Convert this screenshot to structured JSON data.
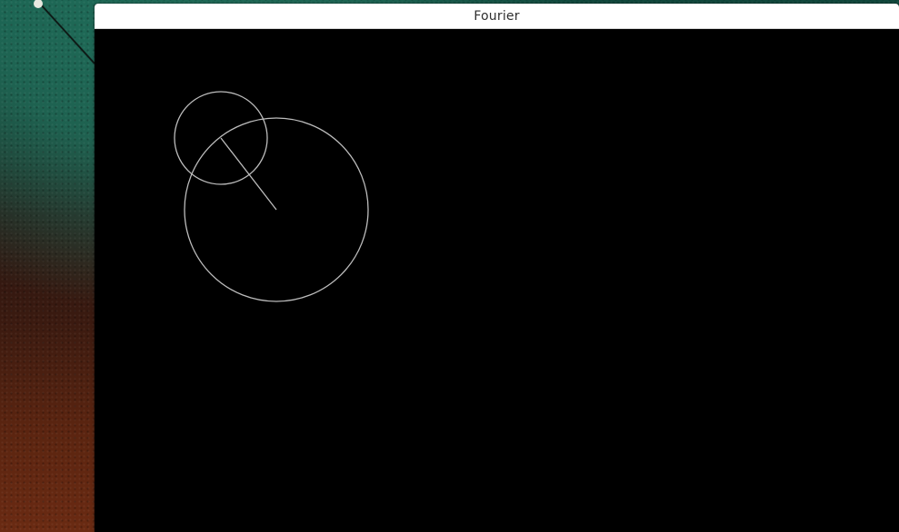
{
  "window": {
    "title": "Fourier"
  },
  "colors": {
    "canvas_background": "#000000",
    "stroke": "#bdbdbd",
    "titlebar_background": "#ffffff",
    "title_text": "#2e2e2e"
  }
}
